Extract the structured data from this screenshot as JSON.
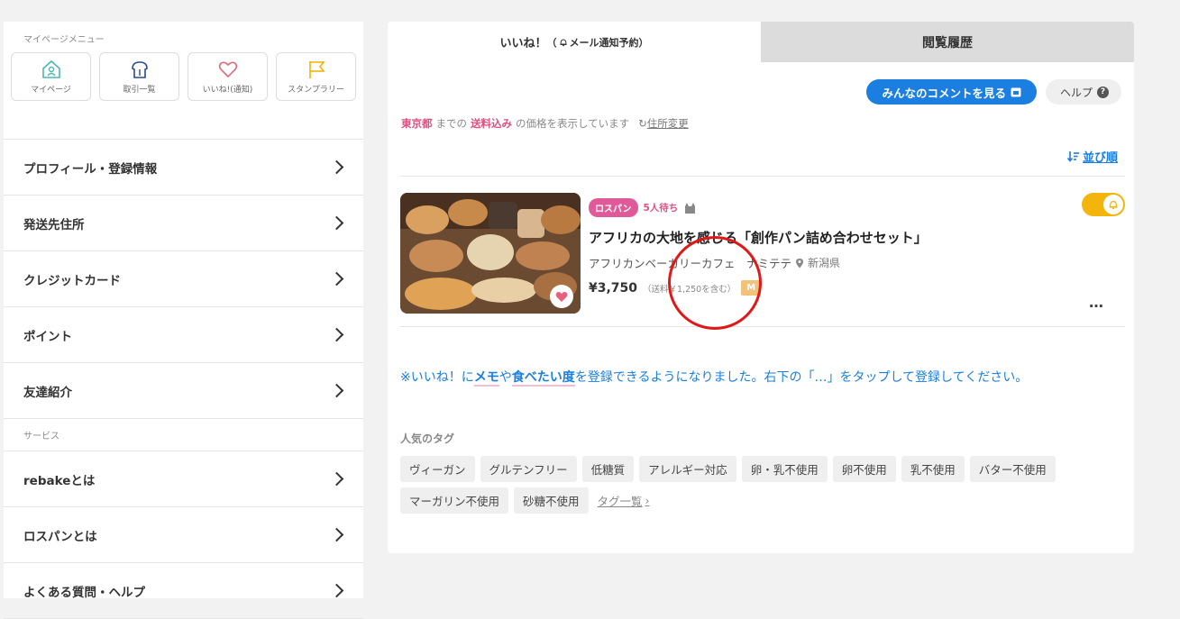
{
  "sidebar": {
    "heading": "マイページメニュー",
    "quick": [
      {
        "label": "マイページ",
        "icon": "home-icon"
      },
      {
        "label": "取引一覧",
        "icon": "bread-icon"
      },
      {
        "label": "いいね!(通知)",
        "icon": "heart-icon"
      },
      {
        "label": "スタンプラリー",
        "icon": "flag-icon"
      }
    ],
    "items": [
      {
        "label": "プロフィール・登録情報"
      },
      {
        "label": "発送先住所"
      },
      {
        "label": "クレジットカード"
      },
      {
        "label": "ポイント"
      },
      {
        "label": "友達紹介"
      }
    ],
    "services_heading": "サービス",
    "service_items": [
      {
        "label": "rebakeとは"
      },
      {
        "label": "ロスパンとは"
      },
      {
        "label": "よくある質問・ヘルプ"
      }
    ]
  },
  "tabs": {
    "likes": {
      "main": "いいね！",
      "paren_open": "（",
      "paren_text": "メール通知予約",
      "paren_close": "）"
    },
    "history": "閲覧履歴"
  },
  "actions": {
    "comments": "みんなのコメントを見る",
    "help": "ヘルプ",
    "help_icon": "?"
  },
  "notice": {
    "pref": "東京都",
    "made": "までの",
    "shipping": "送料込み",
    "rest": "の価格を表示しています",
    "change": "住所変更"
  },
  "sort": {
    "label": "並び順"
  },
  "product": {
    "badge": "ロスパン",
    "waiting": "5人待ち",
    "title": "アフリカの大地を感じる「創作パン詰め合わせセット」",
    "shop": "アフリカンベーカリーカフェ　ナミテテ",
    "prefecture": "新潟県",
    "price": "¥3,750",
    "shipping": "（送料￥1,250を含む）",
    "m_badge": "M",
    "more": "…",
    "notify_on": true
  },
  "info": {
    "part1": "※いいね！に",
    "memo": "メモ",
    "part2": "や",
    "want": "食べたい度",
    "part3": "を登録できるようになりました。右下の「…」をタップして登録してください。"
  },
  "popular": {
    "title": "人気のタグ",
    "tags": [
      "ヴィーガン",
      "グルテンフリー",
      "低糖質",
      "アレルギー対応",
      "卵・乳不使用",
      "卵不使用",
      "乳不使用",
      "バター不使用",
      "マーガリン不使用",
      "砂糖不使用"
    ],
    "more": "タグ一覧"
  },
  "colors": {
    "accent_blue": "#1a7fe0",
    "pink": "#e0507f",
    "toggle_yellow": "#f3b40c",
    "annotation_red": "#e01818"
  }
}
